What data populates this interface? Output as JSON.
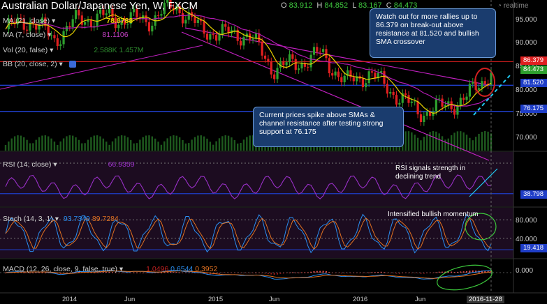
{
  "header": {
    "title": "Australian Dollar/Japanese Yen, W, FXCM",
    "ohlc": [
      {
        "label": "O",
        "value": "83.912"
      },
      {
        "label": "H",
        "value": "84.852"
      },
      {
        "label": "L",
        "value": "83.167"
      },
      {
        "label": "C",
        "value": "84.473"
      }
    ],
    "realtime_label": "realtime"
  },
  "indicators": {
    "ma21": {
      "label": "MA (21, close)",
      "value": "78.8788"
    },
    "ma7": {
      "label": "MA (7, close)",
      "value": "81.1106"
    },
    "vol": {
      "label": "Vol (20, false)",
      "value": "2.588K",
      "value2": "1.457M"
    },
    "bb": {
      "label": "BB (20, close, 2)"
    },
    "rsi": {
      "label": "RSI (14, close)",
      "value": "66.9359"
    },
    "stoch": {
      "label": "Stoch (14, 3, 1)",
      "value": "93.7349",
      "value2": "89.7284"
    },
    "macd": {
      "label": "MACD (12, 26, close, 9, false, true)",
      "value": "1.0496",
      "value2": "0.6544",
      "value3": "0.3952"
    }
  },
  "price_axis": {
    "ticks": [
      "95.000",
      "90.000",
      "85.000",
      "80.000",
      "75.000",
      "70.000"
    ],
    "tags": [
      {
        "label": "86.379",
        "color": "#e02020"
      },
      {
        "label": "84.473",
        "color": "#2ea02e"
      },
      {
        "label": "81.520",
        "color": "#1f3ec8"
      },
      {
        "label": "76.175",
        "color": "#1f3ec8"
      }
    ]
  },
  "rsi_axis": {
    "tag": "38.798"
  },
  "stoch_axis": {
    "ticks": [
      "80.000",
      "40.000"
    ],
    "tag": "19.418"
  },
  "macd_axis": {
    "ticks": [
      "0.000"
    ]
  },
  "x_axis": {
    "ticks": [
      "2014",
      "Jun",
      "2015",
      "Jun",
      "2016",
      "Jun"
    ],
    "current": "2016-11-28"
  },
  "annotations": {
    "resistance_callout": "Watch out for more rallies up to 86.379 on break-out above resistance at 81.520 and bullish SMA crossover",
    "support_callout": "Current prices spike above SMAs & channel resistance after testing strong support at 76.175",
    "rsi_note": "RSI signals strength in declining trend",
    "stoch_note": "Intensified bullish momentum"
  },
  "colors": {
    "up": "#2ea02e",
    "down": "#e02020",
    "ma21": "#b21bb2",
    "ma7": "#e8d000",
    "channel": "#c020c0",
    "support": "#1f3ec8",
    "resistance": "#e02020",
    "rsi": "#9a30c8",
    "stoch_k": "#2a8ef0",
    "stoch_d": "#e07020",
    "panel_bg": "#1c0c20"
  },
  "chart_data": {
    "type": "candlestick",
    "title": "Australian Dollar/Japanese Yen, W, FXCM",
    "x_range": [
      "2013-09",
      "2016-11-28"
    ],
    "ylim": [
      68,
      97
    ],
    "levels": {
      "resistance": 86.379,
      "breakout": 81.52,
      "support": 76.175,
      "last": 84.473
    },
    "weekly_close_approx": [
      {
        "t": "2013-10",
        "c": 93
      },
      {
        "t": "2013-12",
        "c": 95
      },
      {
        "t": "2014-02",
        "c": 91
      },
      {
        "t": "2014-04",
        "c": 95
      },
      {
        "t": "2014-06",
        "c": 95.5
      },
      {
        "t": "2014-08",
        "c": 95
      },
      {
        "t": "2014-10",
        "c": 95
      },
      {
        "t": "2014-12",
        "c": 98
      },
      {
        "t": "2015-02",
        "c": 93
      },
      {
        "t": "2015-04",
        "c": 92
      },
      {
        "t": "2015-06",
        "c": 92
      },
      {
        "t": "2015-08",
        "c": 85
      },
      {
        "t": "2015-10",
        "c": 86
      },
      {
        "t": "2015-12",
        "c": 88
      },
      {
        "t": "2016-01",
        "c": 82
      },
      {
        "t": "2016-03",
        "c": 84
      },
      {
        "t": "2016-05",
        "c": 80
      },
      {
        "t": "2016-06",
        "c": 76
      },
      {
        "t": "2016-08",
        "c": 77
      },
      {
        "t": "2016-10",
        "c": 79
      },
      {
        "t": "2016-11",
        "c": 84.5
      }
    ],
    "series": [
      {
        "name": "MA (21, close)",
        "last": 78.8788
      },
      {
        "name": "MA (7, close)",
        "last": 81.1106
      },
      {
        "name": "RSI (14, close)",
        "last": 66.9359
      },
      {
        "name": "Stoch (14, 3, 1)",
        "last_k": 93.7349,
        "last_d": 89.7284
      },
      {
        "name": "MACD (12, 26, close, 9, false, true)",
        "macd": 1.0496,
        "signal": 0.6544,
        "hist": 0.3952
      }
    ]
  }
}
